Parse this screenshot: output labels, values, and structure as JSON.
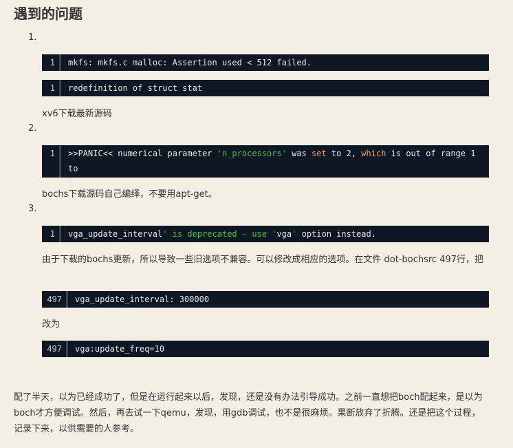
{
  "heading": "遇到的问题",
  "items": [
    {
      "number": "1.",
      "code_blocks": [
        {
          "line_no": "1",
          "text": "mkfs: mkfs.c malloc: Assertion used < 512 failed."
        },
        {
          "line_no": "1",
          "text": "redefinition of struct stat"
        }
      ],
      "note": "xv6下载最新源码"
    },
    {
      "number": "2.",
      "code_blocks": [
        {
          "line_no": "1",
          "parts": [
            ">>PANIC<< numerical parameter ",
            "'n_processors'",
            " was ",
            "set",
            " to 2, ",
            "which",
            " is out of range 1 to\n1"
          ]
        }
      ],
      "note": "bochs下载源码自己编绎，不要用apt-get。"
    },
    {
      "number": "3.",
      "code_blocks": [
        {
          "line_no": "1",
          "parts": [
            "vga_update_interval",
            "' is deprecated - use '",
            "vga",
            "'",
            " option instead."
          ]
        }
      ],
      "note": "由于下载的bochs更新，所以导致一些旧选项不兼容。可以修改成相应的选项。在文件 dot-bochsrc 497行，把",
      "code_after_note": {
        "line_no": "497",
        "text": "vga_update_interval: 300000"
      },
      "change_to": "改为",
      "code_after_change": {
        "line_no": "497",
        "text": "vga:update_freq=10"
      }
    }
  ],
  "closing": "配了半天，以为已经成功了，但是在运行起来以后，发现，还是没有办法引导成功。之前一直想把boch配起来，是以为boch才方便调试。然后，再去试一下qemu，发现，用gdb调试，也不是很麻烦。果断放弃了折腾。还是把这个过程，记录下来，以供需要的人参考。",
  "colors": {
    "background": "#f4eee5",
    "code_background": "#0f1624",
    "string_token": "#3cc43c",
    "keyword_token": "#f5a04a"
  }
}
